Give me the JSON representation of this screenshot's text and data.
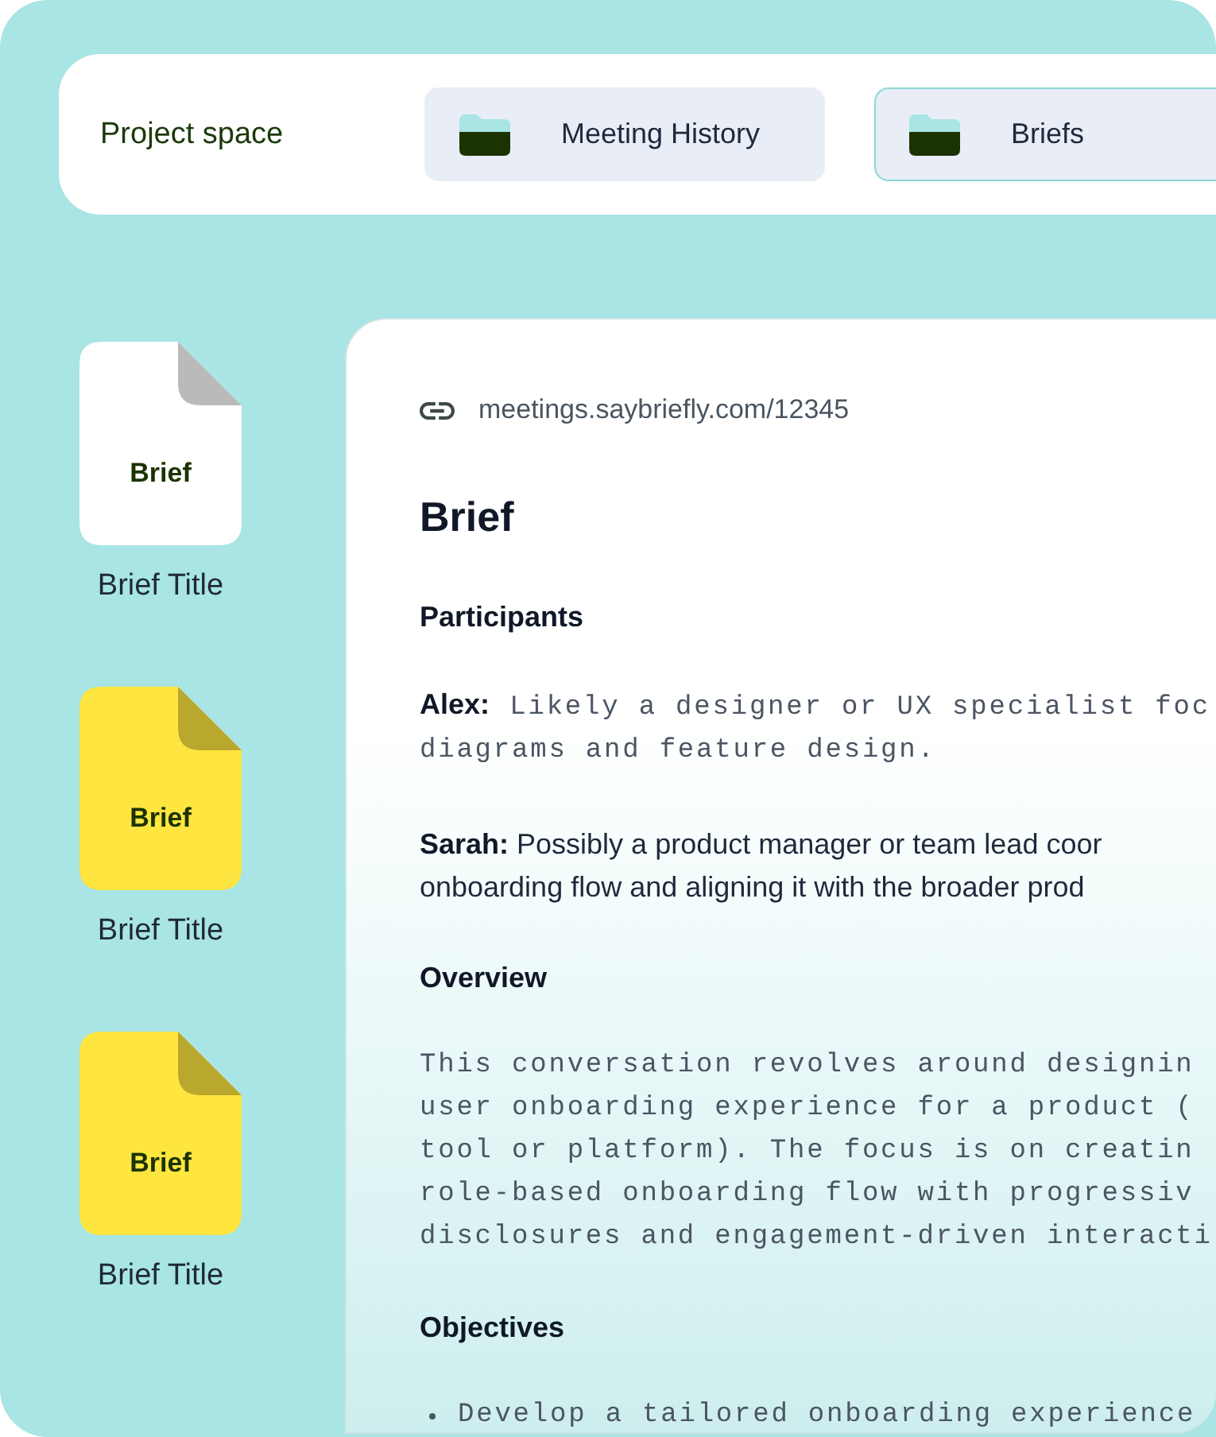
{
  "top_bar": {
    "label": "Project space",
    "tabs": [
      {
        "label": "Meeting History",
        "selected": false
      },
      {
        "label": "Briefs",
        "selected": true
      }
    ]
  },
  "briefs": [
    {
      "file_label": "Brief",
      "title": "Brief Title",
      "color": "#ffffff"
    },
    {
      "file_label": "Brief",
      "title": "Brief Title",
      "color": "#ffe53f"
    },
    {
      "file_label": "Brief",
      "title": "Brief Title",
      "color": "#ffe53f"
    }
  ],
  "document": {
    "link": "meetings.saybriefly.com/12345",
    "title": "Brief",
    "sections": [
      {
        "kind": "heading",
        "text": "Participants"
      },
      {
        "kind": "mono",
        "lines": [
          "**Alex:** Likely a designer or UX specialist foc",
          "diagrams and feature design."
        ]
      },
      {
        "kind": "text",
        "lines": [
          "**Sarah:** Possibly a product manager or team lead coor",
          "onboarding flow and aligning it with the broader prod"
        ]
      },
      {
        "kind": "heading",
        "text": "Overview"
      },
      {
        "kind": "mono",
        "lines": [
          "This conversation revolves around designin",
          "user onboarding experience for a product (",
          "tool or platform). The focus is on creatin",
          "role-based onboarding flow with progressiv",
          "disclosures and engagement-driven interacti"
        ]
      },
      {
        "kind": "heading",
        "text": "Objectives"
      },
      {
        "kind": "list",
        "items": [
          "Develop a tailored onboarding experience"
        ]
      }
    ]
  }
}
